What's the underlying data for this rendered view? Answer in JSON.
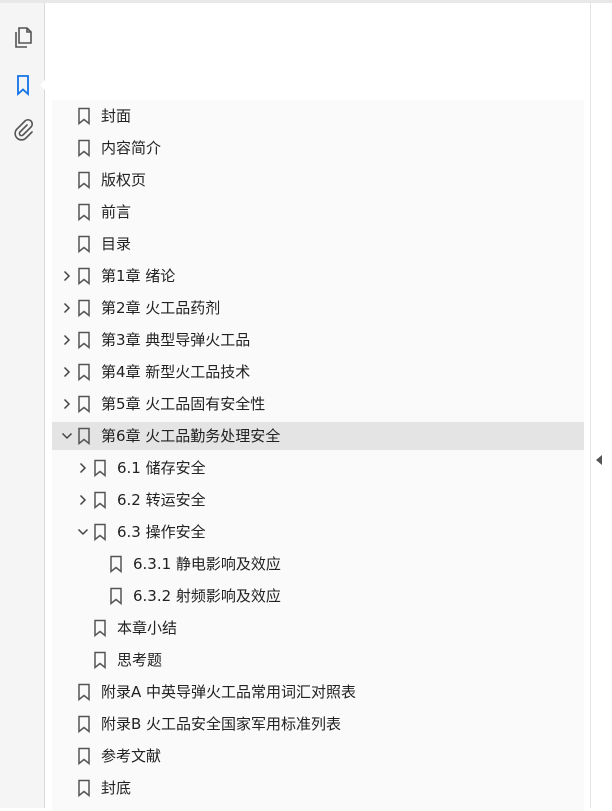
{
  "rail": {
    "icons": [
      "pages-icon",
      "bookmarks-icon",
      "attachments-icon"
    ],
    "active": "bookmarks-icon",
    "accent_color": "#1473e6"
  },
  "bookmarks": [
    {
      "label": "封面",
      "level": 0,
      "expander": "none"
    },
    {
      "label": "内容简介",
      "level": 0,
      "expander": "none"
    },
    {
      "label": "版权页",
      "level": 0,
      "expander": "none"
    },
    {
      "label": "前言",
      "level": 0,
      "expander": "none"
    },
    {
      "label": "目录",
      "level": 0,
      "expander": "none"
    },
    {
      "label": "第1章 绪论",
      "level": 0,
      "expander": "collapsed"
    },
    {
      "label": "第2章 火工品药剂",
      "level": 0,
      "expander": "collapsed"
    },
    {
      "label": "第3章 典型导弹火工品",
      "level": 0,
      "expander": "collapsed"
    },
    {
      "label": "第4章 新型火工品技术",
      "level": 0,
      "expander": "collapsed"
    },
    {
      "label": "第5章 火工品固有安全性",
      "level": 0,
      "expander": "collapsed"
    },
    {
      "label": "第6章 火工品勤务处理安全",
      "level": 0,
      "expander": "expanded",
      "selected": true
    },
    {
      "label": "6.1 储存安全",
      "level": 1,
      "expander": "collapsed"
    },
    {
      "label": "6.2 转运安全",
      "level": 1,
      "expander": "collapsed"
    },
    {
      "label": "6.3 操作安全",
      "level": 1,
      "expander": "expanded"
    },
    {
      "label": "6.3.1 静电影响及效应",
      "level": 2,
      "expander": "none"
    },
    {
      "label": "6.3.2 射频影响及效应",
      "level": 2,
      "expander": "none"
    },
    {
      "label": "本章小结",
      "level": 1,
      "expander": "none"
    },
    {
      "label": "思考题",
      "level": 1,
      "expander": "none"
    },
    {
      "label": "附录A 中英导弹火工品常用词汇对照表",
      "level": 0,
      "expander": "none"
    },
    {
      "label": "附录B 火工品安全国家军用标准列表",
      "level": 0,
      "expander": "none"
    },
    {
      "label": "参考文献",
      "level": 0,
      "expander": "none"
    },
    {
      "label": "封底",
      "level": 0,
      "expander": "none"
    }
  ]
}
